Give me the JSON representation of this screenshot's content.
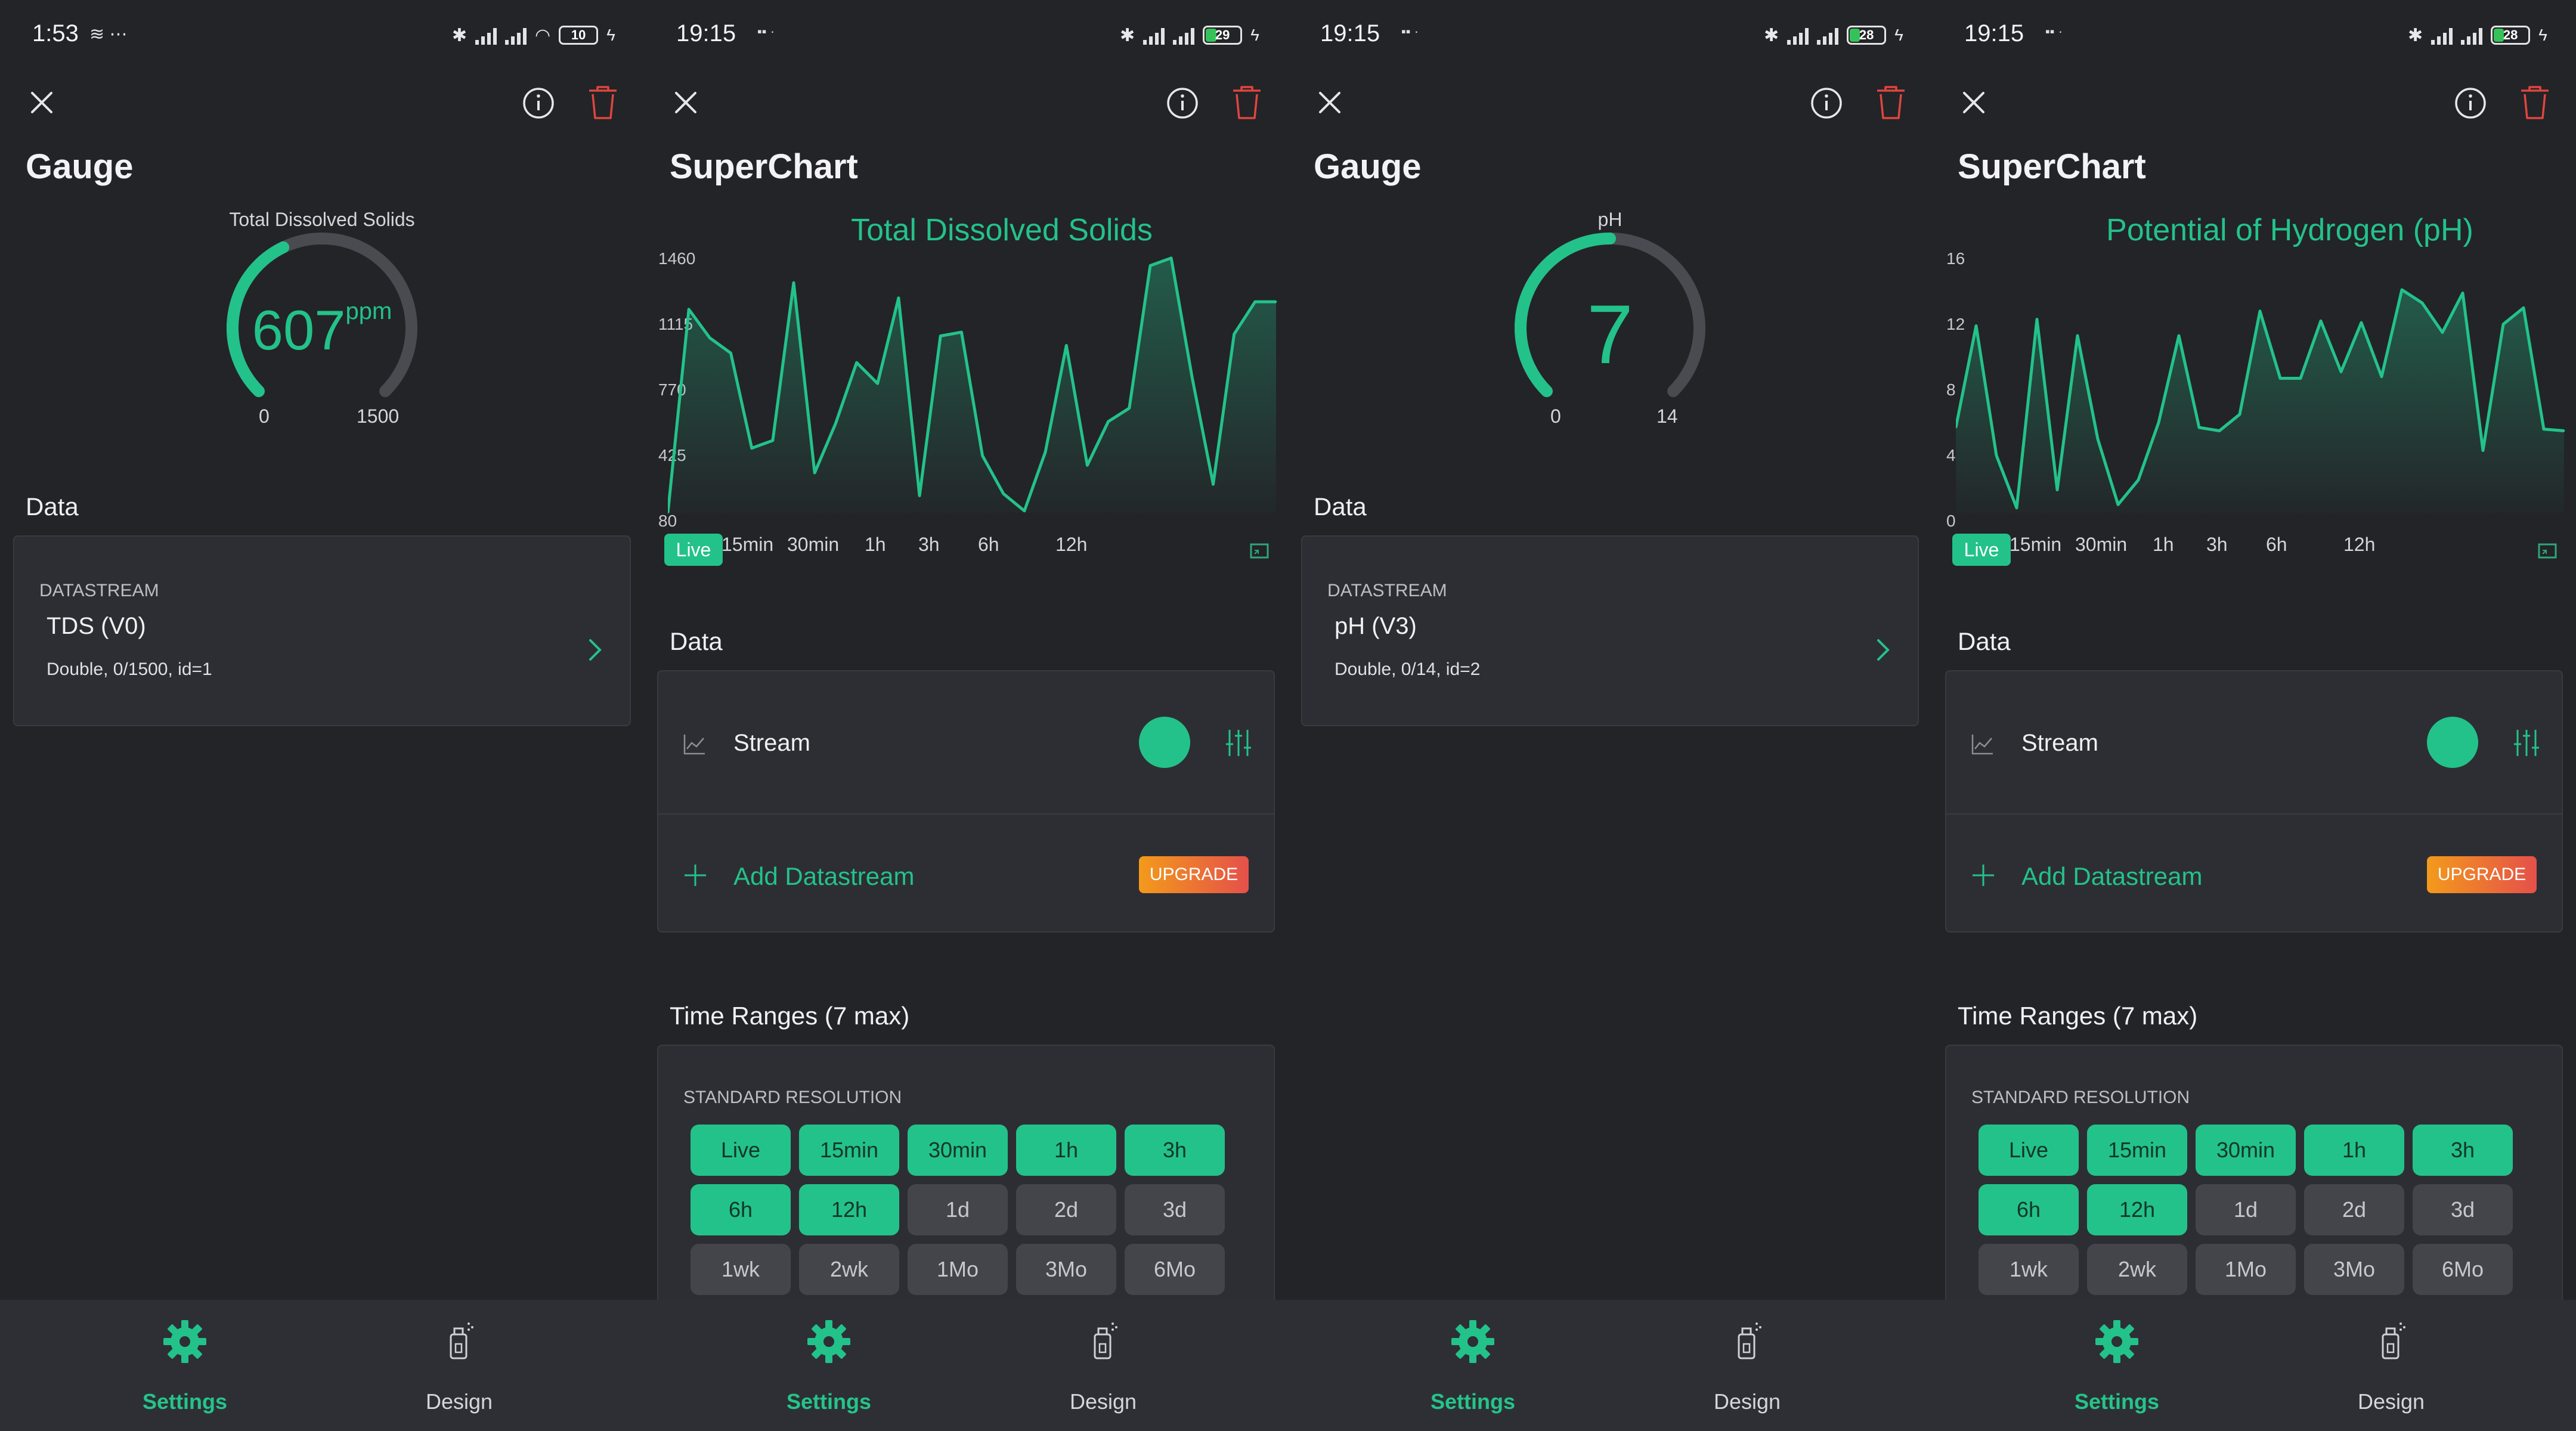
{
  "screens": [
    {
      "status_time": "1:53",
      "battery": "10",
      "widget_title": "Gauge",
      "gauge": {
        "label": "Total Dissolved Solids",
        "value": "607",
        "unit": "ppm",
        "min": "0",
        "max": "1500",
        "fraction": 0.405
      },
      "data_section": "Data",
      "datastream": {
        "header": "DATASTREAM",
        "name": "TDS (V0)",
        "details": "Double, 0/1500, id=1"
      }
    },
    {
      "status_time": "19:15",
      "battery": "29",
      "widget_title": "SuperChart",
      "chart_title": "Total Dissolved Solids",
      "yticks": [
        "1460",
        "1115",
        "770",
        "425",
        "80"
      ],
      "tabs": [
        "Live",
        "15min",
        "30min",
        "1h",
        "3h",
        "6h",
        "12h"
      ],
      "data_section": "Data",
      "stream_label": "Stream",
      "add_datastream": "Add Datastream",
      "upgrade": "UPGRADE",
      "time_ranges_title": "Time Ranges (7 max)",
      "standard_resolution": "STANDARD RESOLUTION"
    },
    {
      "status_time": "19:15",
      "battery": "28",
      "widget_title": "Gauge",
      "gauge": {
        "label": "pH",
        "value": "7",
        "unit": "",
        "min": "0",
        "max": "14",
        "fraction": 0.5
      },
      "data_section": "Data",
      "datastream": {
        "header": "DATASTREAM",
        "name": "pH (V3)",
        "details": "Double, 0/14, id=2"
      }
    },
    {
      "status_time": "19:15",
      "battery": "28",
      "widget_title": "SuperChart",
      "chart_title": "Potential of Hydrogen (pH)",
      "yticks": [
        "16",
        "12",
        "8",
        "4",
        "0"
      ],
      "tabs": [
        "Live",
        "15min",
        "30min",
        "1h",
        "3h",
        "6h",
        "12h"
      ],
      "data_section": "Data",
      "stream_label": "Stream",
      "add_datastream": "Add Datastream",
      "upgrade": "UPGRADE",
      "time_ranges_title": "Time Ranges (7 max)",
      "standard_resolution": "STANDARD RESOLUTION"
    }
  ],
  "time_range_buttons": [
    {
      "label": "Live",
      "selected": true
    },
    {
      "label": "15min",
      "selected": true
    },
    {
      "label": "30min",
      "selected": true
    },
    {
      "label": "1h",
      "selected": true
    },
    {
      "label": "3h",
      "selected": true
    },
    {
      "label": "6h",
      "selected": true
    },
    {
      "label": "12h",
      "selected": true
    },
    {
      "label": "1d",
      "selected": false
    },
    {
      "label": "2d",
      "selected": false
    },
    {
      "label": "3d",
      "selected": false
    },
    {
      "label": "1wk",
      "selected": false
    },
    {
      "label": "2wk",
      "selected": false
    },
    {
      "label": "1Mo",
      "selected": false
    },
    {
      "label": "3Mo",
      "selected": false
    },
    {
      "label": "6Mo",
      "selected": false
    }
  ],
  "nav": {
    "settings": "Settings",
    "design": "Design"
  },
  "colors": {
    "accent": "#23c28a",
    "background": "#232427",
    "card": "#2d2e33",
    "danger": "#e0453f",
    "upgrade_start": "#f39a1b",
    "upgrade_end": "#e5504a"
  },
  "icons": [
    "close-icon",
    "info-icon",
    "trash-icon",
    "chevron-right-icon",
    "line-chart-icon",
    "equalizer-icon",
    "plus-icon",
    "gear-icon",
    "design-icon",
    "fullscreen-icon"
  ],
  "chart_data": [
    {
      "type": "area",
      "title": "Total Dissolved Solids",
      "ylim": [
        80,
        1460
      ],
      "yticks": [
        80,
        425,
        770,
        1115,
        1460
      ],
      "series": [
        {
          "values": [
            80,
            1150,
            1000,
            920,
            420,
            460,
            1290,
            290,
            550,
            870,
            760,
            1210,
            170,
            1010,
            1030,
            380,
            180,
            90,
            400,
            960,
            330,
            560,
            630,
            1380,
            1420,
            790,
            230,
            1020,
            1190,
            1190
          ]
        }
      ],
      "grid": false
    },
    {
      "type": "area",
      "title": "Potential of Hydrogen (pH)",
      "ylim": [
        0,
        16
      ],
      "yticks": [
        0,
        4,
        8,
        12,
        16
      ],
      "series": [
        {
          "values": [
            5.2,
            11.4,
            3.5,
            0.3,
            11.8,
            1.4,
            10.8,
            4.5,
            0.5,
            2.0,
            5.5,
            10.8,
            5.2,
            5.0,
            6.0,
            12.3,
            8.2,
            8.2,
            11.7,
            8.6,
            11.6,
            8.3,
            13.6,
            12.8,
            11.0,
            13.4,
            3.8,
            11.5,
            12.5,
            5.1,
            5.0
          ]
        }
      ],
      "grid": false
    }
  ]
}
